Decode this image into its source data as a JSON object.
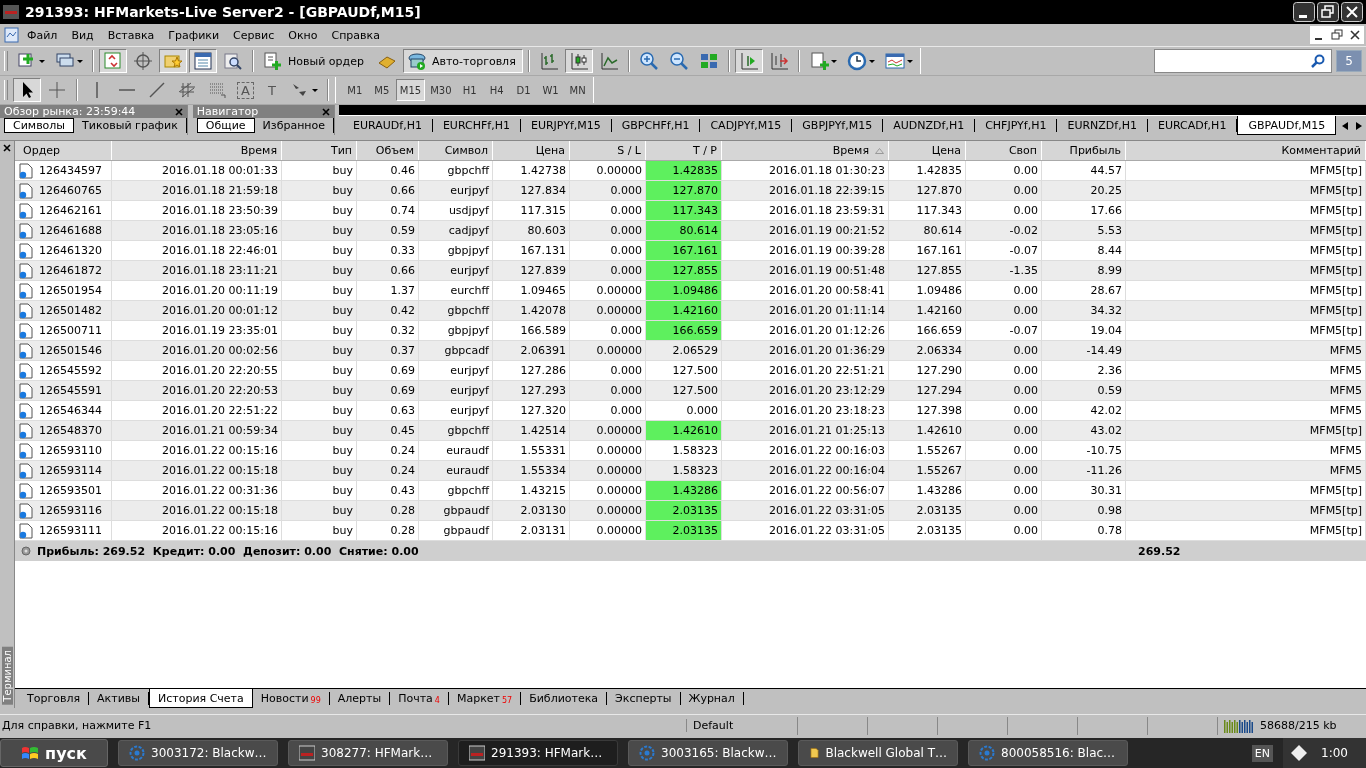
{
  "window": {
    "title": "291393: HFMarkets-Live Server2 - [GBPAUDf,M15]"
  },
  "menu": [
    "Файл",
    "Вид",
    "Вставка",
    "Графики",
    "Сервис",
    "Окно",
    "Справка"
  ],
  "toolbar": [
    {
      "kind": "dropdown",
      "pressed": false
    },
    {
      "kind": "dropdown",
      "pressed": false
    },
    {
      "kind": "separator"
    },
    {
      "kind": "button",
      "pressed": true
    },
    {
      "kind": "button",
      "pressed": false
    },
    {
      "kind": "button",
      "pressed": true
    },
    {
      "kind": "button",
      "pressed": true
    },
    {
      "kind": "button",
      "pressed": false
    },
    {
      "kind": "separator"
    },
    {
      "kind": "labeled",
      "label": "Новый ордер",
      "pressed": false
    },
    {
      "kind": "button",
      "pressed": false
    },
    {
      "kind": "labeled",
      "label": "Авто-торговля",
      "pressed": true
    },
    {
      "kind": "separator"
    },
    {
      "kind": "button",
      "pressed": false
    },
    {
      "kind": "button",
      "pressed": true
    },
    {
      "kind": "button",
      "pressed": false
    },
    {
      "kind": "separator"
    },
    {
      "kind": "button",
      "pressed": false
    },
    {
      "kind": "button",
      "pressed": false
    },
    {
      "kind": "button",
      "pressed": false
    },
    {
      "kind": "separator"
    },
    {
      "kind": "button",
      "pressed": true
    },
    {
      "kind": "button",
      "pressed": false
    },
    {
      "kind": "separator"
    },
    {
      "kind": "dropdown",
      "pressed": false
    },
    {
      "kind": "dropdown",
      "pressed": false
    },
    {
      "kind": "dropdown",
      "pressed": false
    }
  ],
  "drawing_toolbar": [
    {
      "kind": "button",
      "pressed": true
    },
    {
      "kind": "button",
      "pressed": false
    },
    {
      "kind": "separator"
    },
    {
      "kind": "button",
      "pressed": false
    },
    {
      "kind": "button",
      "pressed": false
    },
    {
      "kind": "button",
      "pressed": false
    },
    {
      "kind": "button",
      "pressed": false
    },
    {
      "kind": "button",
      "pressed": false
    },
    {
      "kind": "glyph",
      "label": "A",
      "pressed": false
    },
    {
      "kind": "glyph",
      "label": "T",
      "pressed": false
    },
    {
      "kind": "dropdown",
      "pressed": false
    },
    {
      "kind": "separator"
    }
  ],
  "timeframes": [
    {
      "label": "M1",
      "selected": false
    },
    {
      "label": "M5",
      "selected": false
    },
    {
      "label": "M15",
      "selected": true
    },
    {
      "label": "M30",
      "selected": false
    },
    {
      "label": "H1",
      "selected": false
    },
    {
      "label": "H4",
      "selected": false
    },
    {
      "label": "D1",
      "selected": false
    },
    {
      "label": "W1",
      "selected": false
    },
    {
      "label": "MN",
      "selected": false
    }
  ],
  "notifications_badge": "5",
  "market_watch": {
    "title": "Обзор рынка: 23:59:44",
    "tabs": [
      {
        "label": "Символы",
        "selected": true
      },
      {
        "label": "Тиковый график",
        "selected": false
      }
    ]
  },
  "navigator": {
    "title": "Навигатор",
    "tabs": [
      {
        "label": "Общие",
        "selected": true
      },
      {
        "label": "Избранное",
        "selected": false
      }
    ]
  },
  "chart_tabs": [
    {
      "label": "EURAUDf,H1",
      "selected": false
    },
    {
      "label": "EURCHFf,H1",
      "selected": false
    },
    {
      "label": "EURJPYf,M15",
      "selected": false
    },
    {
      "label": "GBPCHFf,H1",
      "selected": false
    },
    {
      "label": "CADJPYf,M15",
      "selected": false
    },
    {
      "label": "GBPJPYf,M15",
      "selected": false
    },
    {
      "label": "AUDNZDf,H1",
      "selected": false
    },
    {
      "label": "CHFJPYf,H1",
      "selected": false
    },
    {
      "label": "EURNZDf,H1",
      "selected": false
    },
    {
      "label": "EURCADf,H1",
      "selected": false
    },
    {
      "label": "GBPAUDf,M15",
      "selected": true
    }
  ],
  "terminal": {
    "label": "Терминал",
    "columns": [
      {
        "label": "Ордер",
        "sorted": false
      },
      {
        "label": "Время",
        "sorted": false
      },
      {
        "label": "Тип",
        "sorted": false
      },
      {
        "label": "Объем",
        "sorted": false
      },
      {
        "label": "Символ",
        "sorted": false
      },
      {
        "label": "Цена",
        "sorted": false
      },
      {
        "label": "S / L",
        "sorted": false
      },
      {
        "label": "T / P",
        "sorted": false
      },
      {
        "label": "Время",
        "sorted": true
      },
      {
        "label": "Цена",
        "sorted": false
      },
      {
        "label": "Своп",
        "sorted": false
      },
      {
        "label": "Прибыль",
        "sorted": false
      },
      {
        "label": "Комментарий",
        "sorted": false
      }
    ],
    "rows": [
      {
        "cells": [
          "126434597",
          "2016.01.18 00:01:33",
          "buy",
          "0.46",
          "gbpchff",
          "1.42738",
          "0.00000",
          "1.42835",
          "2016.01.18 01:30:23",
          "1.42835",
          "0.00",
          "44.57",
          "MFM5[tp]"
        ],
        "tp_hit": true
      },
      {
        "cells": [
          "126460765",
          "2016.01.18 21:59:18",
          "buy",
          "0.66",
          "eurjpyf",
          "127.834",
          "0.000",
          "127.870",
          "2016.01.18 22:39:15",
          "127.870",
          "0.00",
          "20.25",
          "MFM5[tp]"
        ],
        "tp_hit": true
      },
      {
        "cells": [
          "126462161",
          "2016.01.18 23:50:39",
          "buy",
          "0.74",
          "usdjpyf",
          "117.315",
          "0.000",
          "117.343",
          "2016.01.18 23:59:31",
          "117.343",
          "0.00",
          "17.66",
          "MFM5[tp]"
        ],
        "tp_hit": true
      },
      {
        "cells": [
          "126461688",
          "2016.01.18 23:05:16",
          "buy",
          "0.59",
          "cadjpyf",
          "80.603",
          "0.000",
          "80.614",
          "2016.01.19 00:21:52",
          "80.614",
          "-0.02",
          "5.53",
          "MFM5[tp]"
        ],
        "tp_hit": true
      },
      {
        "cells": [
          "126461320",
          "2016.01.18 22:46:01",
          "buy",
          "0.33",
          "gbpjpyf",
          "167.131",
          "0.000",
          "167.161",
          "2016.01.19 00:39:28",
          "167.161",
          "-0.07",
          "8.44",
          "MFM5[tp]"
        ],
        "tp_hit": true
      },
      {
        "cells": [
          "126461872",
          "2016.01.18 23:11:21",
          "buy",
          "0.66",
          "eurjpyf",
          "127.839",
          "0.000",
          "127.855",
          "2016.01.19 00:51:48",
          "127.855",
          "-1.35",
          "8.99",
          "MFM5[tp]"
        ],
        "tp_hit": true
      },
      {
        "cells": [
          "126501954",
          "2016.01.20 00:11:19",
          "buy",
          "1.37",
          "eurchff",
          "1.09465",
          "0.00000",
          "1.09486",
          "2016.01.20 00:58:41",
          "1.09486",
          "0.00",
          "28.67",
          "MFM5[tp]"
        ],
        "tp_hit": true
      },
      {
        "cells": [
          "126501482",
          "2016.01.20 00:01:12",
          "buy",
          "0.42",
          "gbpchff",
          "1.42078",
          "0.00000",
          "1.42160",
          "2016.01.20 01:11:14",
          "1.42160",
          "0.00",
          "34.32",
          "MFM5[tp]"
        ],
        "tp_hit": true
      },
      {
        "cells": [
          "126500711",
          "2016.01.19 23:35:01",
          "buy",
          "0.32",
          "gbpjpyf",
          "166.589",
          "0.000",
          "166.659",
          "2016.01.20 01:12:26",
          "166.659",
          "-0.07",
          "19.04",
          "MFM5[tp]"
        ],
        "tp_hit": true
      },
      {
        "cells": [
          "126501546",
          "2016.01.20 00:02:56",
          "buy",
          "0.37",
          "gbpcadf",
          "2.06391",
          "0.00000",
          "2.06529",
          "2016.01.20 01:36:29",
          "2.06334",
          "0.00",
          "-14.49",
          "MFM5"
        ],
        "tp_hit": false
      },
      {
        "cells": [
          "126545592",
          "2016.01.20 22:20:55",
          "buy",
          "0.69",
          "eurjpyf",
          "127.286",
          "0.000",
          "127.500",
          "2016.01.20 22:51:21",
          "127.290",
          "0.00",
          "2.36",
          "MFM5"
        ],
        "tp_hit": false
      },
      {
        "cells": [
          "126545591",
          "2016.01.20 22:20:53",
          "buy",
          "0.69",
          "eurjpyf",
          "127.293",
          "0.000",
          "127.500",
          "2016.01.20 23:12:29",
          "127.294",
          "0.00",
          "0.59",
          "MFM5"
        ],
        "tp_hit": false
      },
      {
        "cells": [
          "126546344",
          "2016.01.20 22:51:22",
          "buy",
          "0.63",
          "eurjpyf",
          "127.320",
          "0.000",
          "0.000",
          "2016.01.20 23:18:23",
          "127.398",
          "0.00",
          "42.02",
          "MFM5"
        ],
        "tp_hit": false
      },
      {
        "cells": [
          "126548370",
          "2016.01.21 00:59:34",
          "buy",
          "0.45",
          "gbpchff",
          "1.42514",
          "0.00000",
          "1.42610",
          "2016.01.21 01:25:13",
          "1.42610",
          "0.00",
          "43.02",
          "MFM5[tp]"
        ],
        "tp_hit": true
      },
      {
        "cells": [
          "126593110",
          "2016.01.22 00:15:16",
          "buy",
          "0.24",
          "euraudf",
          "1.55331",
          "0.00000",
          "1.58323",
          "2016.01.22 00:16:03",
          "1.55267",
          "0.00",
          "-10.75",
          "MFM5"
        ],
        "tp_hit": false
      },
      {
        "cells": [
          "126593114",
          "2016.01.22 00:15:18",
          "buy",
          "0.24",
          "euraudf",
          "1.55334",
          "0.00000",
          "1.58323",
          "2016.01.22 00:16:04",
          "1.55267",
          "0.00",
          "-11.26",
          "MFM5"
        ],
        "tp_hit": false
      },
      {
        "cells": [
          "126593501",
          "2016.01.22 00:31:36",
          "buy",
          "0.43",
          "gbpchff",
          "1.43215",
          "0.00000",
          "1.43286",
          "2016.01.22 00:56:07",
          "1.43286",
          "0.00",
          "30.31",
          "MFM5[tp]"
        ],
        "tp_hit": true
      },
      {
        "cells": [
          "126593116",
          "2016.01.22 00:15:18",
          "buy",
          "0.28",
          "gbpaudf",
          "2.03130",
          "0.00000",
          "2.03135",
          "2016.01.22 03:31:05",
          "2.03135",
          "0.00",
          "0.98",
          "MFM5[tp]"
        ],
        "tp_hit": true
      },
      {
        "cells": [
          "126593111",
          "2016.01.22 00:15:16",
          "buy",
          "0.28",
          "gbpaudf",
          "2.03131",
          "0.00000",
          "2.03135",
          "2016.01.22 03:31:05",
          "2.03135",
          "0.00",
          "0.78",
          "MFM5[tp]"
        ],
        "tp_hit": true
      }
    ],
    "summary": {
      "text": "Прибыль: 269.52  Кредит: 0.00  Депозит: 0.00  Снятие: 0.00",
      "profit": "269.52"
    },
    "tabs": [
      {
        "label": "Торговля",
        "selected": false
      },
      {
        "label": "Активы",
        "selected": false
      },
      {
        "label": "История Счета",
        "selected": true
      },
      {
        "label": "Новости",
        "selected": false,
        "badge": "99"
      },
      {
        "label": "Алерты",
        "selected": false
      },
      {
        "label": "Почта",
        "selected": false,
        "badge": "4"
      },
      {
        "label": "Маркет",
        "selected": false,
        "badge": "57"
      },
      {
        "label": "Библиотека",
        "selected": false
      },
      {
        "label": "Эксперты",
        "selected": false
      },
      {
        "label": "Журнал",
        "selected": false
      }
    ]
  },
  "status_bar": {
    "help": "Для справки, нажмите F1",
    "profile": "Default",
    "traffic": "58688/215 kb"
  },
  "taskbar": {
    "start": "пуск",
    "tasks": [
      {
        "kind": "globe",
        "label": "3003172: Blackw…",
        "selected": false
      },
      {
        "kind": "terminal",
        "label": "308277: HFMark…",
        "selected": false
      },
      {
        "kind": "terminal",
        "label": "291393: HFMark…",
        "selected": true
      },
      {
        "kind": "globe",
        "label": "3003165: Blackw…",
        "selected": false
      },
      {
        "kind": "folder",
        "label": "Blackwell Global T…",
        "selected": false
      },
      {
        "kind": "globe",
        "label": "800058516: Blac…",
        "selected": false
      }
    ],
    "language": "EN",
    "clock": "1:00"
  }
}
